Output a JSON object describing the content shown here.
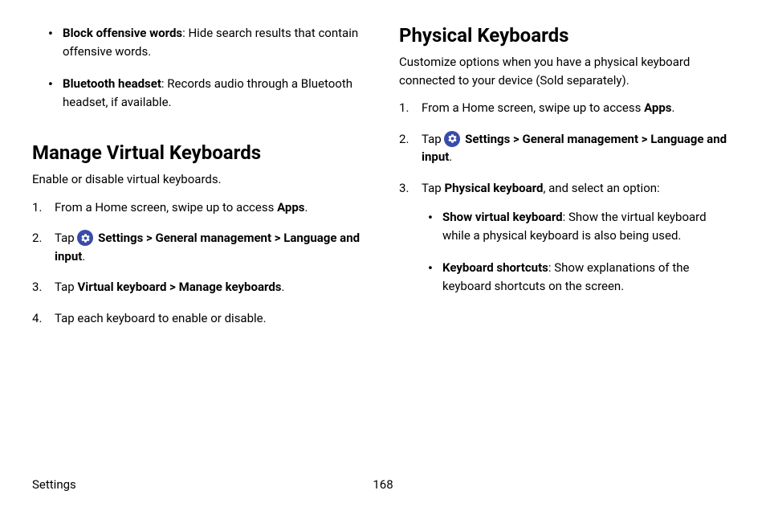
{
  "left": {
    "bullets": [
      {
        "term": "Block offensive words",
        "desc": ": Hide search results that contain offensive words."
      },
      {
        "term": "Bluetooth headset",
        "desc": ": Records audio through a Bluetooth headset, if available."
      }
    ],
    "heading": "Manage Virtual Keyboards",
    "intro": "Enable or disable virtual keyboards.",
    "step1_a": "From a Home screen, swipe up to access ",
    "step1_b": "Apps",
    "step1_c": ".",
    "step2_a": "Tap ",
    "step2_b": "Settings",
    "step2_c": " > ",
    "step2_d": "General management",
    "step2_e": " > ",
    "step2_f": "Language and input",
    "step2_g": ".",
    "step3_a": "Tap ",
    "step3_b": "Virtual keyboard",
    "step3_c": " > ",
    "step3_d": "Manage keyboards",
    "step3_e": ".",
    "step4": "Tap each keyboard to enable or disable."
  },
  "right": {
    "heading": "Physical Keyboards",
    "intro": "Customize options when you have a physical keyboard connected to your device (Sold separately).",
    "step1_a": "From a Home screen, swipe up to access ",
    "step1_b": "Apps",
    "step1_c": ".",
    "step2_a": "Tap ",
    "step2_b": "Settings",
    "step2_c": " > ",
    "step2_d": "General management",
    "step2_e": " > ",
    "step2_f": "Language and input",
    "step2_g": ".",
    "step3_a": "Tap ",
    "step3_b": "Physical keyboard",
    "step3_c": ", and select an option:",
    "sub_bullets": [
      {
        "term": "Show virtual keyboard",
        "desc": ": Show the virtual keyboard while a physical keyboard is also being used."
      },
      {
        "term": "Keyboard shortcuts",
        "desc": ": Show explanations of the keyboard shortcuts on the screen."
      }
    ]
  },
  "footer": {
    "left": "Settings",
    "page": "168"
  }
}
